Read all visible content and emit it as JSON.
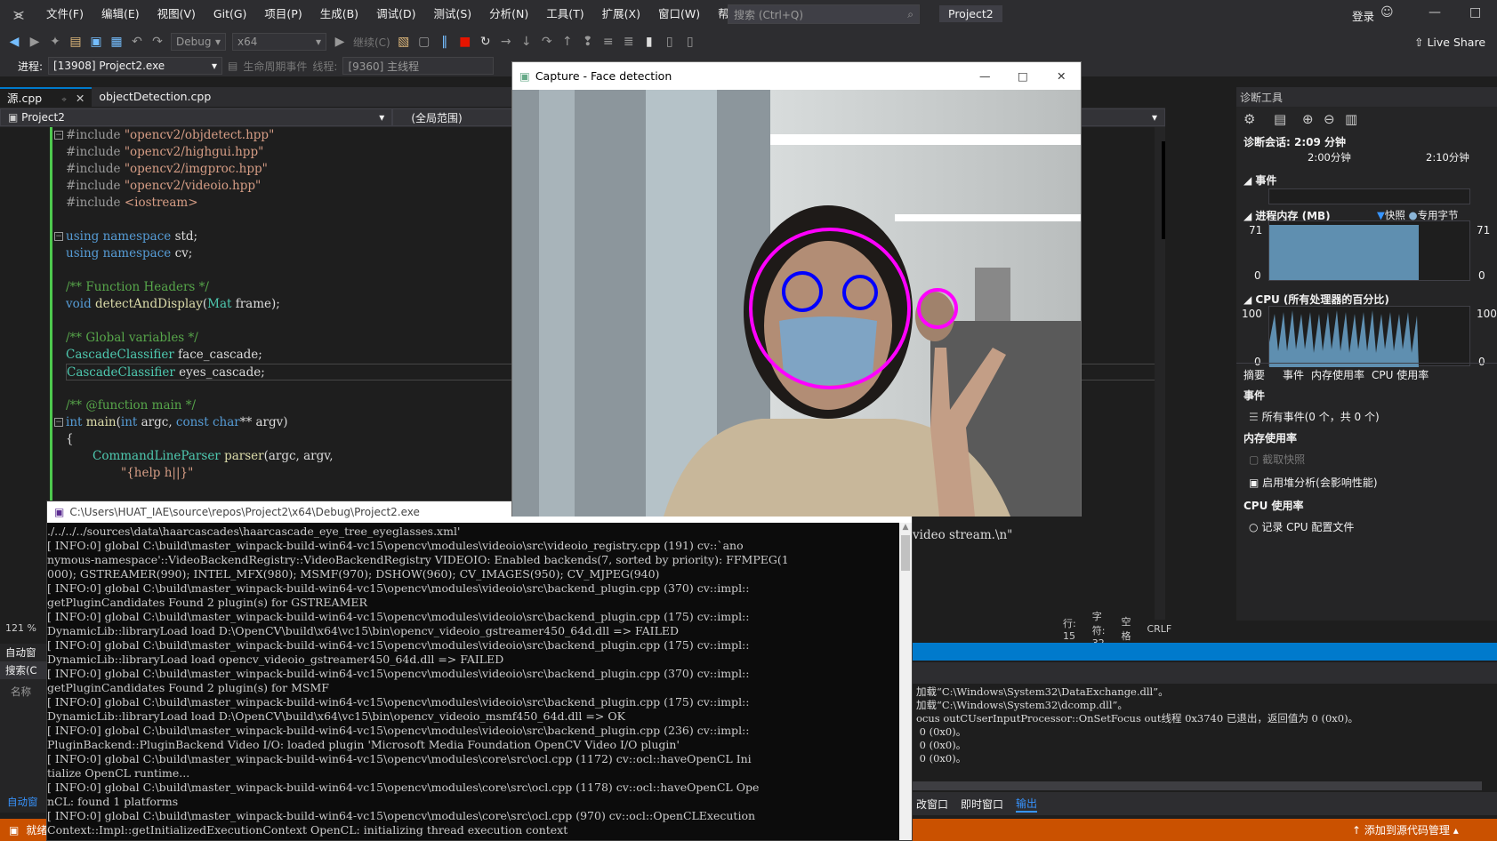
{
  "menubar": {
    "items": [
      "文件(F)",
      "编辑(E)",
      "视图(V)",
      "Git(G)",
      "项目(P)",
      "生成(B)",
      "调试(D)",
      "测试(S)",
      "分析(N)",
      "工具(T)",
      "扩展(X)",
      "窗口(W)",
      "帮助(H)"
    ],
    "search_placeholder": "搜索 (Ctrl+Q)",
    "solution_name": "Project2",
    "login": "登录"
  },
  "toolbar": {
    "config": "Debug",
    "platform": "x64",
    "continue_label": "继续(C)",
    "live_share": "Live Share"
  },
  "process_bar": {
    "process_label": "进程:",
    "process_value": "[13908] Project2.exe",
    "lifecycle": "生命周期事件",
    "thread_label": "线程:",
    "thread_value": "[9360] 主线程"
  },
  "tabs": [
    {
      "label": "源.cpp",
      "active": true
    },
    {
      "label": "objectDetection.cpp",
      "active": false
    }
  ],
  "navbar": {
    "project": "Project2",
    "scope": "(全局范围)"
  },
  "editor": {
    "zoom": "121 %",
    "line": "行: 15",
    "col": "字符: 32",
    "space": "空格",
    "eol": "CRLF",
    "trailing_text": "video stream.\\n\""
  },
  "capture_window": {
    "title": "Capture - Face detection"
  },
  "console": {
    "title": "C:\\Users\\HUAT_IAE\\source\\repos\\Project2\\x64\\Debug\\Project2.exe",
    "lines": [
      "./../../../sources\\data\\haarcascades\\haarcascade_eye_tree_eyeglasses.xml'",
      "[ INFO:0] global C:\\build\\master_winpack-build-win64-vc15\\opencv\\modules\\videoio\\src\\videoio_registry.cpp (191) cv::`ano",
      "nymous-namespace'::VideoBackendRegistry::VideoBackendRegistry VIDEOIO: Enabled backends(7, sorted by priority): FFMPEG(1",
      "000); GSTREAMER(990); INTEL_MFX(980); MSMF(970); DSHOW(960); CV_IMAGES(950); CV_MJPEG(940)",
      "[ INFO:0] global C:\\build\\master_winpack-build-win64-vc15\\opencv\\modules\\videoio\\src\\backend_plugin.cpp (370) cv::impl::",
      "getPluginCandidates Found 2 plugin(s) for GSTREAMER",
      "[ INFO:0] global C:\\build\\master_winpack-build-win64-vc15\\opencv\\modules\\videoio\\src\\backend_plugin.cpp (175) cv::impl::",
      "DynamicLib::libraryLoad load D:\\OpenCV\\build\\x64\\vc15\\bin\\opencv_videoio_gstreamer450_64d.dll => FAILED",
      "[ INFO:0] global C:\\build\\master_winpack-build-win64-vc15\\opencv\\modules\\videoio\\src\\backend_plugin.cpp (175) cv::impl::",
      "DynamicLib::libraryLoad load opencv_videoio_gstreamer450_64d.dll => FAILED",
      "[ INFO:0] global C:\\build\\master_winpack-build-win64-vc15\\opencv\\modules\\videoio\\src\\backend_plugin.cpp (370) cv::impl::",
      "getPluginCandidates Found 2 plugin(s) for MSMF",
      "[ INFO:0] global C:\\build\\master_winpack-build-win64-vc15\\opencv\\modules\\videoio\\src\\backend_plugin.cpp (175) cv::impl::",
      "DynamicLib::libraryLoad load D:\\OpenCV\\build\\x64\\vc15\\bin\\opencv_videoio_msmf450_64d.dll => OK",
      "[ INFO:0] global C:\\build\\master_winpack-build-win64-vc15\\opencv\\modules\\videoio\\src\\backend_plugin.cpp (236) cv::impl::",
      "PluginBackend::PluginBackend Video I/O: loaded plugin 'Microsoft Media Foundation OpenCV Video I/O plugin'",
      "[ INFO:0] global C:\\build\\master_winpack-build-win64-vc15\\opencv\\modules\\core\\src\\ocl.cpp (1172) cv::ocl::haveOpenCL Ini",
      "tialize OpenCL runtime...",
      "[ INFO:0] global C:\\build\\master_winpack-build-win64-vc15\\opencv\\modules\\core\\src\\ocl.cpp (1178) cv::ocl::haveOpenCL Ope",
      "nCL: found 1 platforms",
      "[ INFO:0] global C:\\build\\master_winpack-build-win64-vc15\\opencv\\modules\\core\\src\\ocl.cpp (970) cv::ocl::OpenCLExecution",
      "Context::Impl::getInitializedExecutionContext OpenCL: initializing thread execution context"
    ]
  },
  "diag": {
    "title": "诊断工具",
    "session": "诊断会话: 2:09 分钟",
    "t1": "2:00分钟",
    "t2": "2:10分钟",
    "events": "事件",
    "memory": "进程内存 (MB)",
    "snapshot": "快照",
    "private_bytes": "专用字节",
    "mem_max": "71",
    "mem_min": "0",
    "cpu": "CPU (所有处理器的百分比)",
    "cpu_max": "100",
    "cpu_min": "0",
    "tabs": [
      "摘要",
      "事件",
      "内存使用率",
      "CPU 使用率"
    ],
    "events_head": "事件",
    "all_events": "所有事件(0 个，共 0 个)",
    "mem_usage": "内存使用率",
    "take_snapshot": "截取快照",
    "heap": "启用堆分析(会影响性能)",
    "cpu_usage": "CPU 使用率",
    "record_cpu": "记录 CPU 配置文件"
  },
  "output": {
    "lines": [
      "加载“C:\\Windows\\System32\\DataExchange.dll”。",
      "加载“C:\\Windows\\System32\\dcomp.dll”。",
      "ocus outCUserInputProcessor::OnSetFocus out线程 0x3740 已退出，返回值为 0 (0x0)。",
      " 0 (0x0)。",
      " 0 (0x0)。",
      " 0 (0x0)。"
    ],
    "tabs": [
      "改窗口",
      "即时窗口",
      "输出"
    ]
  },
  "autowin": {
    "title": "自动窗",
    "search": "搜索(C",
    "name": "名称",
    "bottom": "自动窗"
  },
  "statusbar": {
    "ready": "就绪",
    "source_control": "添加到源代码管理"
  }
}
